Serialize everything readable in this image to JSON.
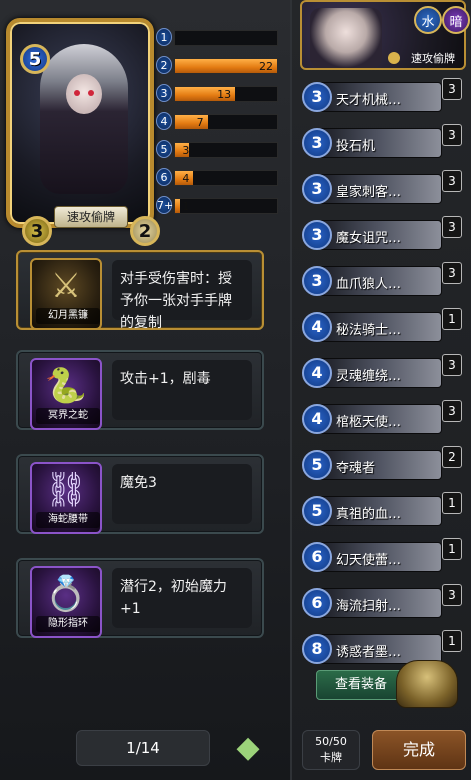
{
  "hero": {
    "name": "速攻偷牌",
    "mana": "5",
    "attack": "3",
    "health": "2"
  },
  "mana_curve": [
    {
      "cost": "1",
      "count": "",
      "fill": 0.0
    },
    {
      "cost": "2",
      "count": "22",
      "fill": 1.0
    },
    {
      "cost": "3",
      "count": "13",
      "fill": 0.59
    },
    {
      "cost": "4",
      "count": "7",
      "fill": 0.32
    },
    {
      "cost": "5",
      "count": "3",
      "fill": 0.14
    },
    {
      "cost": "6",
      "count": "4",
      "fill": 0.18
    },
    {
      "cost": "7+",
      "count": "1",
      "fill": 0.05
    }
  ],
  "equipment": [
    {
      "name": "幻月黑镰",
      "text": "对手受伤害时：授予你一张对手手牌的复制",
      "icon": "scythe-icon",
      "style": "gold",
      "glyph": "⚔"
    },
    {
      "name": "冥界之蛇",
      "text": "攻击+1，剧毒",
      "icon": "serpent-icon",
      "style": "purple",
      "glyph": "🐍"
    },
    {
      "name": "海蛇腰带",
      "text": "魔免3",
      "icon": "belt-icon",
      "style": "purple",
      "glyph": "⛓"
    },
    {
      "name": "隐形指环",
      "text": "潜行2，初始魔力+1",
      "icon": "ring-icon",
      "style": "purple",
      "glyph": "💍"
    }
  ],
  "pager": {
    "label": "1/14"
  },
  "deck": {
    "title": "速攻偷牌",
    "badges": [
      "水",
      "暗"
    ],
    "cards": [
      {
        "cost": "3",
        "name": "天才机械…",
        "count": "3"
      },
      {
        "cost": "3",
        "name": "投石机",
        "count": "3"
      },
      {
        "cost": "3",
        "name": "皇家刺客…",
        "count": "3"
      },
      {
        "cost": "3",
        "name": "魔女诅咒…",
        "count": "3"
      },
      {
        "cost": "3",
        "name": "血爪狼人…",
        "count": "3"
      },
      {
        "cost": "4",
        "name": "秘法骑士…",
        "count": "1"
      },
      {
        "cost": "4",
        "name": "灵魂缠绕…",
        "count": "3"
      },
      {
        "cost": "4",
        "name": "棺柩天使…",
        "count": "3"
      },
      {
        "cost": "5",
        "name": "夺魂者",
        "count": "2"
      },
      {
        "cost": "5",
        "name": "真祖的血…",
        "count": "1"
      },
      {
        "cost": "6",
        "name": "幻天使蕾…",
        "count": "1"
      },
      {
        "cost": "6",
        "name": "海流扫射…",
        "count": "3"
      },
      {
        "cost": "8",
        "name": "诱惑者墨…",
        "count": "1"
      }
    ],
    "view_equipment_label": "查看装备",
    "count_value": "50/50",
    "count_label": "卡牌",
    "done_label": "完成"
  },
  "colors": {
    "accent_gold": "#b98f34",
    "bar_orange": "#e37b12",
    "mana_blue": "#1b4e9c",
    "purple_frame": "#8b54c9"
  }
}
